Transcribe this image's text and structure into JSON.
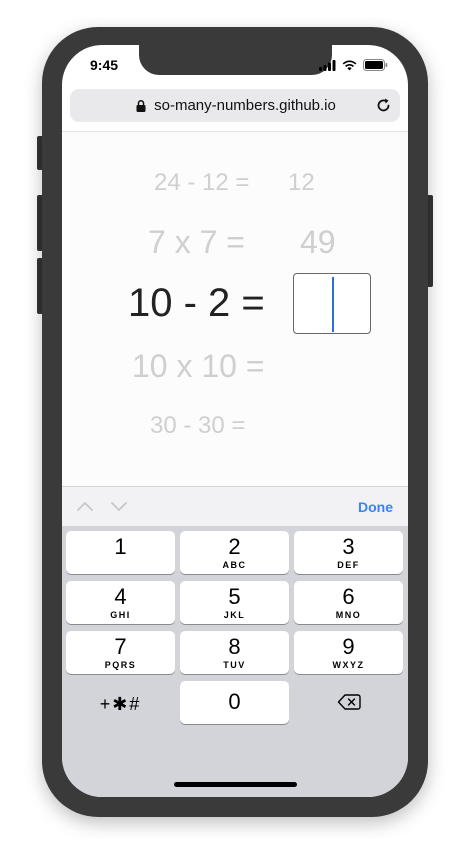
{
  "status": {
    "time": "9:45"
  },
  "browser": {
    "url": "so-many-numbers.github.io"
  },
  "problems": [
    {
      "equation": "24 - 12 =",
      "answer": "12"
    },
    {
      "equation": "7 x 7 =",
      "answer": "49"
    },
    {
      "equation": "10 - 2 =",
      "answer": ""
    },
    {
      "equation": "10 x 10 =",
      "answer": ""
    },
    {
      "equation": "30 - 30 =",
      "answer": ""
    }
  ],
  "accessory": {
    "done_label": "Done"
  },
  "keypad": {
    "keys": [
      {
        "num": "1",
        "letters": ""
      },
      {
        "num": "2",
        "letters": "ABC"
      },
      {
        "num": "3",
        "letters": "DEF"
      },
      {
        "num": "4",
        "letters": "GHI"
      },
      {
        "num": "5",
        "letters": "JKL"
      },
      {
        "num": "6",
        "letters": "MNO"
      },
      {
        "num": "7",
        "letters": "PQRS"
      },
      {
        "num": "8",
        "letters": "TUV"
      },
      {
        "num": "9",
        "letters": "WXYZ"
      }
    ],
    "symbols_label": "+✱#",
    "zero": "0"
  },
  "colors": {
    "accent": "#3a82f7",
    "faded_text": "#cfcfcf",
    "active_text": "#222222",
    "caret": "#2d6fd6"
  }
}
